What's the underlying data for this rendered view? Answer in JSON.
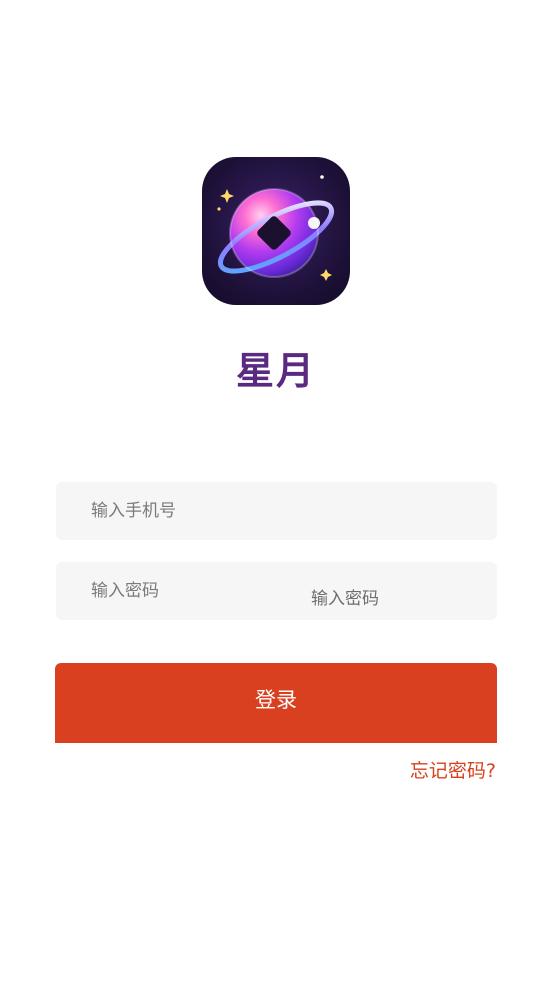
{
  "app": {
    "name": "星月",
    "logo_icon": "planet-logo-icon"
  },
  "form": {
    "phone_placeholder": "输入手机号",
    "password_placeholder": "输入密码",
    "password_overlay_label": "输入密码",
    "login_label": "登录",
    "forgot_password_label": "忘记密码?"
  },
  "colors": {
    "brand_purple": "#5a2a82",
    "primary_button": "#d8401f",
    "field_background": "#f6f6f6"
  }
}
